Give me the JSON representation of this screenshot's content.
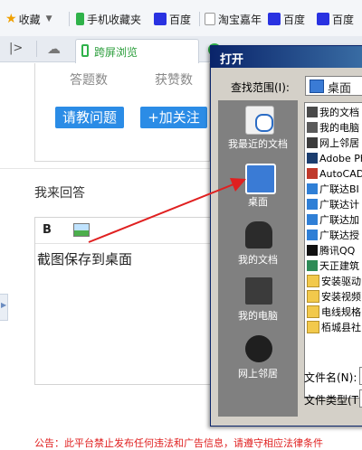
{
  "browser": {
    "bookmarks": [
      {
        "label": "收藏",
        "icon": "star-icon"
      },
      {
        "label": "手机收藏夹",
        "icon": "phone-icon"
      },
      {
        "label": "百度",
        "icon": "baidu-paw-icon"
      },
      {
        "label": "淘宝嘉年",
        "icon": "page-icon"
      },
      {
        "label": "百度",
        "icon": "baidu-paw-icon"
      },
      {
        "label": "百度",
        "icon": "baidu-paw-icon"
      }
    ],
    "active_tab": "跨屏浏览"
  },
  "page": {
    "stats": {
      "answers_label": "答题数",
      "awards_label": "获赞数"
    },
    "ask_button": "请教问题",
    "follow_button": "+加关注",
    "answer_heading": "我来回答",
    "editor": {
      "bold_label": "B",
      "content": "截图保存到桌面"
    },
    "footer_notice": "公告：此平台禁止发布任何违法和广告信息，请遵守相应法律条件"
  },
  "dialog": {
    "title": "打开",
    "look_in_label": "查找范围(I):",
    "look_in_value": "桌面",
    "places": [
      {
        "label": "我最近的文档",
        "icon": "recent-documents-icon"
      },
      {
        "label": "桌面",
        "icon": "desktop-icon"
      },
      {
        "label": "我的文档",
        "icon": "my-documents-icon"
      },
      {
        "label": "我的电脑",
        "icon": "my-computer-icon"
      },
      {
        "label": "网上邻居",
        "icon": "network-places-icon"
      }
    ],
    "files": [
      {
        "name": "我的文档",
        "icon": "documents-folder-icon"
      },
      {
        "name": "我的电脑",
        "icon": "computer-icon"
      },
      {
        "name": "网上邻居",
        "icon": "network-icon"
      },
      {
        "name": "Adobe Ph",
        "icon": "photoshop-icon"
      },
      {
        "name": "AutoCAD",
        "icon": "autocad-icon"
      },
      {
        "name": "广联达BI",
        "icon": "glodon-icon"
      },
      {
        "name": "广联达计",
        "icon": "glodon-icon"
      },
      {
        "name": "广联达加",
        "icon": "glodon-icon"
      },
      {
        "name": "广联达授",
        "icon": "glodon-icon"
      },
      {
        "name": "腾讯QQ",
        "icon": "qq-icon"
      },
      {
        "name": "天正建筑",
        "icon": "tangent-icon"
      },
      {
        "name": "安装驱动",
        "icon": "folder-icon"
      },
      {
        "name": "安装视频",
        "icon": "folder-icon"
      },
      {
        "name": "电线规格",
        "icon": "folder-icon"
      },
      {
        "name": "栢城县社",
        "icon": "folder-icon"
      }
    ],
    "filename_label": "文件名(N):",
    "filetype_label": "文件类型(T):"
  },
  "colors": {
    "blue_button": "#2b8ce6",
    "arrow": "#e02020",
    "dialog_title": "#0a246a",
    "notice": "#e02020"
  }
}
